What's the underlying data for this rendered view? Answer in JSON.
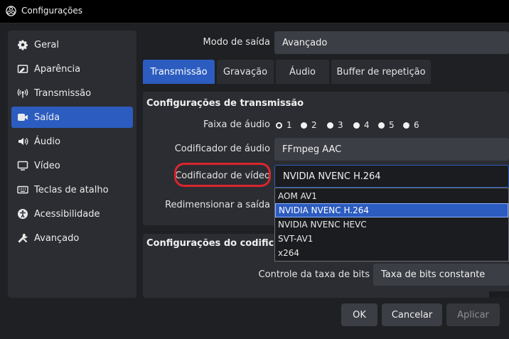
{
  "window": {
    "title": "Configurações"
  },
  "sidebar": {
    "items": [
      {
        "label": "Geral",
        "icon": "gear-icon"
      },
      {
        "label": "Aparência",
        "icon": "appearance-icon"
      },
      {
        "label": "Transmissão",
        "icon": "broadcast-icon"
      },
      {
        "label": "Saída",
        "icon": "output-icon",
        "active": true
      },
      {
        "label": "Áudio",
        "icon": "speaker-icon"
      },
      {
        "label": "Vídeo",
        "icon": "monitor-icon"
      },
      {
        "label": "Teclas de atalho",
        "icon": "keyboard-icon"
      },
      {
        "label": "Acessibilidade",
        "icon": "accessibility-icon"
      },
      {
        "label": "Avançado",
        "icon": "tools-icon"
      }
    ]
  },
  "output_mode": {
    "label": "Modo de saída",
    "value": "Avançado"
  },
  "tabs": [
    {
      "label": "Transmissão",
      "active": true
    },
    {
      "label": "Gravação"
    },
    {
      "label": "Áudio"
    },
    {
      "label": "Buffer de repetição"
    }
  ],
  "stream_settings": {
    "title": "Configurações de transmissão",
    "audio_track": {
      "label": "Faixa de áudio",
      "options": [
        "1",
        "2",
        "3",
        "4",
        "5",
        "6"
      ],
      "selected": "1"
    },
    "audio_encoder": {
      "label": "Codificador de áudio",
      "value": "FFmpeg AAC"
    },
    "video_encoder": {
      "label": "Codificador de vídeo",
      "value": "NVIDIA NVENC H.264"
    },
    "rescale": {
      "label": "Redimensionar a saída"
    }
  },
  "encoder_dropdown": {
    "options": [
      "AOM AV1",
      "NVIDIA NVENC H.264",
      "NVIDIA NVENC HEVC",
      "SVT-AV1",
      "x264"
    ],
    "selected_index": 1
  },
  "encoder_settings": {
    "title": "Configurações do codificado",
    "rate_control": {
      "label": "Controle da taxa de bits",
      "value": "Taxa de bits constante"
    }
  },
  "buttons": {
    "ok": "OK",
    "cancel": "Cancelar",
    "apply": "Aplicar"
  },
  "colors": {
    "accent": "#2c5cbf",
    "highlight_ring": "#d9262e",
    "panel": "#2b2d32",
    "background": "#1f2023"
  }
}
